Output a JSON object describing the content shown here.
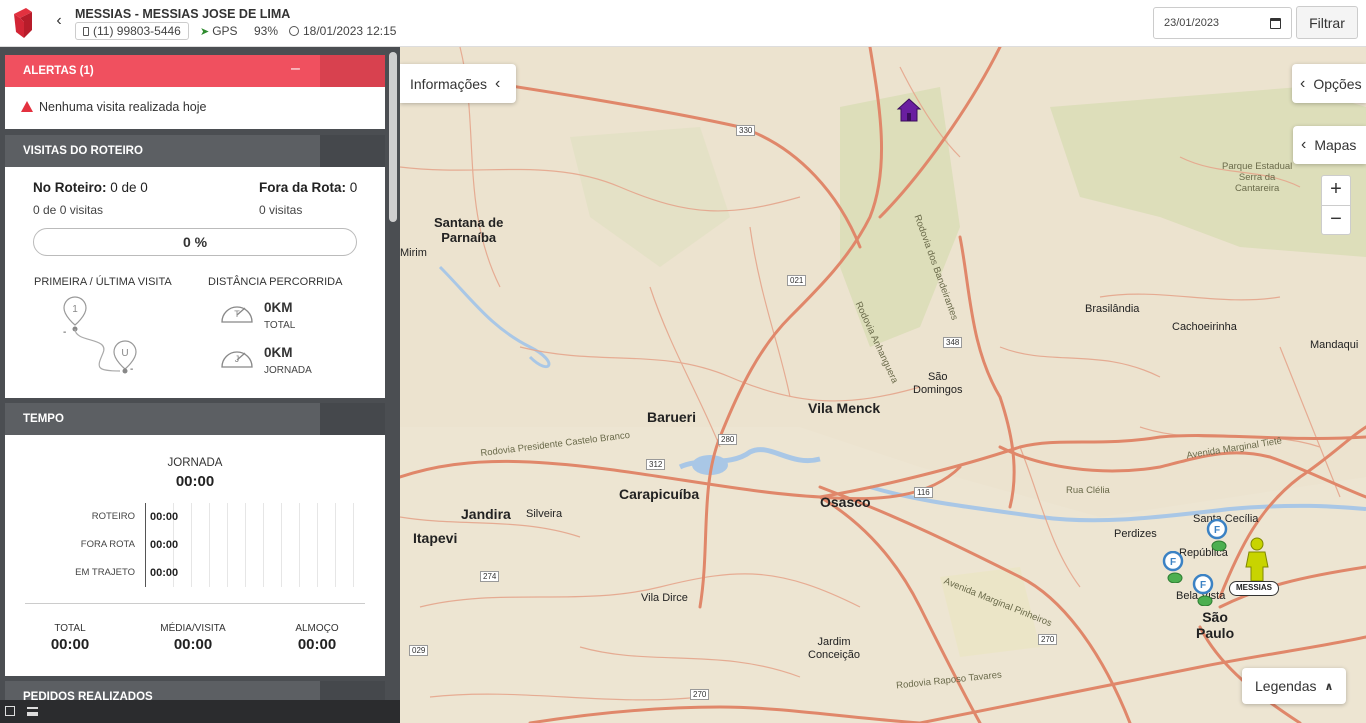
{
  "header": {
    "vendor_name": "MESSIAS - MESSIAS JOSE DE LIMA",
    "phone": "(11) 99803-5446",
    "gps_label": "GPS",
    "battery": "93%",
    "last_update": "18/01/2023 12:15",
    "date_value": "23/01/2023",
    "filter_label": "Filtrar"
  },
  "alerts": {
    "title": "ALERTAS (1)",
    "collapse_symbol": "–",
    "message": "Nenhuma visita realizada hoje"
  },
  "visits": {
    "title": "VISITAS DO ROTEIRO",
    "no_roteiro_label": "No Roteiro:",
    "no_roteiro_value": "0 de 0",
    "no_roteiro_sub": "0 de 0 visitas",
    "fora_rota_label": "Fora da Rota:",
    "fora_rota_value": "0",
    "fora_rota_sub": "0 visitas",
    "progress": "0 %",
    "first_last_title": "PRIMEIRA / ÚLTIMA VISITA",
    "first_marker": "1",
    "last_marker": "U",
    "first_time": "-",
    "last_time": "-",
    "distance_title": "DISTÂNCIA PERCORRIDA",
    "total_km": "0KM",
    "total_caption": "TOTAL",
    "journey_km": "0KM",
    "journey_caption": "JORNADA",
    "gauge_total_letter": "T",
    "gauge_journey_letter": "J"
  },
  "tempo": {
    "title": "TEMPO",
    "jornada_label": "JORNADA",
    "jornada_value": "00:00",
    "rows": [
      {
        "label": "ROTEIRO",
        "value": "00:00"
      },
      {
        "label": "FORA ROTA",
        "value": "00:00"
      },
      {
        "label": "EM TRAJETO",
        "value": "00:00"
      }
    ],
    "total_label": "TOTAL",
    "total_value": "00:00",
    "media_label": "MÉDIA/VISITA",
    "media_value": "00:00",
    "almoco_label": "ALMOÇO",
    "almoco_value": "00:00"
  },
  "pedidos": {
    "title": "PEDIDOS REALIZADOS"
  },
  "map": {
    "info_button": "Informações",
    "options_button": "Opções",
    "maps_button": "Mapas",
    "zoom_in": "+",
    "zoom_out": "−",
    "legend_button": "Legendas",
    "person_tag": "MESSIAS",
    "pin_letter": "F",
    "places": {
      "santana": "Santana de\nParnaíba",
      "mirim": "Mirim",
      "barueri": "Barueri",
      "vila_menck": "Vila Menck",
      "carapicuiba": "Carapicuíba",
      "osasco": "Osasco",
      "jandira": "Jandira",
      "silveira": "Silveira",
      "itapevi": "Itapevi",
      "vila_dirce": "Vila Dirce",
      "jardim_conceicao": "Jardim\nConceição",
      "brasilandia": "Brasilândia",
      "cachoeirinha": "Cachoeirinha",
      "mandaqui": "Mandaqui",
      "sao_domingos": "São\nDomingos",
      "perdizes": "Perdizes",
      "santa_cecilia": "Santa Cecília",
      "republica": "República",
      "bela_vista": "Bela Vista",
      "sao_paulo": "São\nPaulo",
      "rua_clelia": "Rua Clélia",
      "parque": "Parque Estadual\nSerra da\nCantareira",
      "road_castelo": "Rodovia Presidente Castelo Branco",
      "road_marginal": "Avenida Marginal Tietê",
      "road_marginal_pinheiros": "Avenida Marginal Pinheiros",
      "road_raposo": "Rodovia Raposo Tavares",
      "road_bandeirantes": "Rodovia dos Bandeirantes",
      "road_anhanguera": "Rodovia Anhanguera",
      "shield_330": "330",
      "shield_021": "021",
      "shield_348": "348",
      "shield_280": "280",
      "shield_312": "312",
      "shield_116": "116",
      "shield_274": "274",
      "shield_270a": "270",
      "shield_270b": "270",
      "shield_029": "029"
    }
  },
  "colors": {
    "accent": "#f0505f",
    "sidebar_bg": "#4b4e52",
    "map_bg": "#ece3cf",
    "road": "#e0876a",
    "pin_blue": "#3b82c4",
    "money_green": "#4caf50",
    "person": "#c8d400",
    "house": "#6a1fa0"
  },
  "icons": [
    "logo-icon",
    "back-chevron-icon",
    "phone-icon",
    "gps-arrow-icon",
    "clock-icon",
    "calendar-icon",
    "warning-icon",
    "pin-icon",
    "gauge-icon",
    "house-icon",
    "person-icon",
    "money-icon",
    "chevron-left-icon",
    "chevron-up-icon",
    "window-icon",
    "list-icon"
  ]
}
